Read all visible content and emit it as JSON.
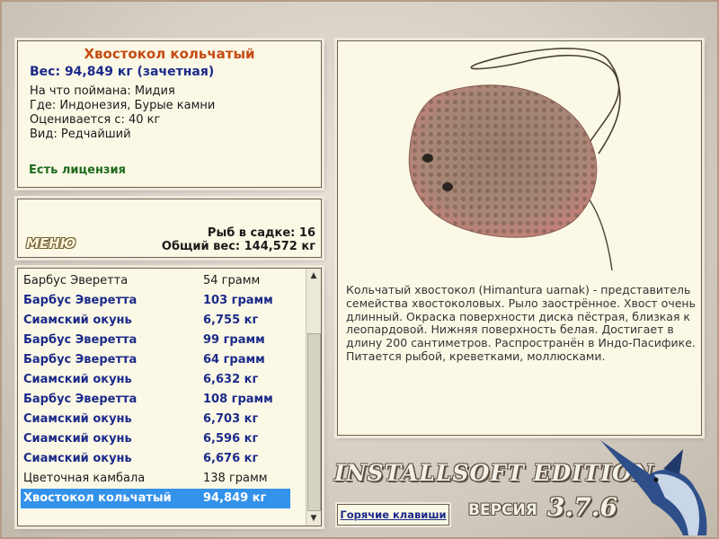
{
  "fish_info": {
    "title": "Хвостокол кольчатый",
    "weight": "Вес: 94,849 кг (зачетная)",
    "bait": "На что поймана: Мидия",
    "place": "Где: Индонезия, Бурые камни",
    "rated": "Оценивается с: 40 кг",
    "kind": "Вид: Редчайший",
    "license": "Есть лицензия"
  },
  "summary": {
    "menu_label": "МЕНЮ",
    "fish_count": "Рыб в садке: 16",
    "total_weight": "Общий вес: 144,572 кг"
  },
  "catch_list": [
    {
      "name": "Барбус Эверетта",
      "weight": "54 грамм",
      "style": "normal"
    },
    {
      "name": "Барбус Эверетта",
      "weight": "103 грамм",
      "style": "bold"
    },
    {
      "name": "Сиамский окунь",
      "weight": "6,755 кг",
      "style": "bold"
    },
    {
      "name": "Барбус Эверетта",
      "weight": "99 грамм",
      "style": "bold"
    },
    {
      "name": "Барбус Эверетта",
      "weight": "64 грамм",
      "style": "bold"
    },
    {
      "name": "Сиамский окунь",
      "weight": "6,632 кг",
      "style": "bold"
    },
    {
      "name": "Барбус Эверетта",
      "weight": "108 грамм",
      "style": "bold"
    },
    {
      "name": "Сиамский окунь",
      "weight": "6,703 кг",
      "style": "bold"
    },
    {
      "name": "Сиамский окунь",
      "weight": "6,596 кг",
      "style": "bold"
    },
    {
      "name": "Сиамский окунь",
      "weight": "6,676 кг",
      "style": "bold"
    },
    {
      "name": "Цветочная камбала",
      "weight": "138 грамм",
      "style": "normal"
    },
    {
      "name": "Хвостокол кольчатый",
      "weight": "94,849 кг",
      "style": "selected"
    }
  ],
  "description": "Кольчатый хвостокол (Himantura uarnak) - представитель семейства хвостоколовых. Рыло заострённое. Хвост очень длинный. Окраска поверхности диска пёстрая, близкая к леопардовой. Нижняя поверхность белая. Достигает в длину 200 сантиметров. Распространён в Индо-Пасифике. Питается рыбой, креветками, моллюсками.",
  "branding": {
    "edition": "INSTALLSOFT EDITION",
    "version_label": "ВЕРСИЯ",
    "version_number": "3.7.6"
  },
  "hotkeys_label": "Горячие клавиши",
  "colors": {
    "title": "#c64a13",
    "accent_blue": "#1c2a8a",
    "license_green": "#1f6b1f",
    "selection": "#3392ea",
    "panel_bg": "#fbf9e6"
  }
}
